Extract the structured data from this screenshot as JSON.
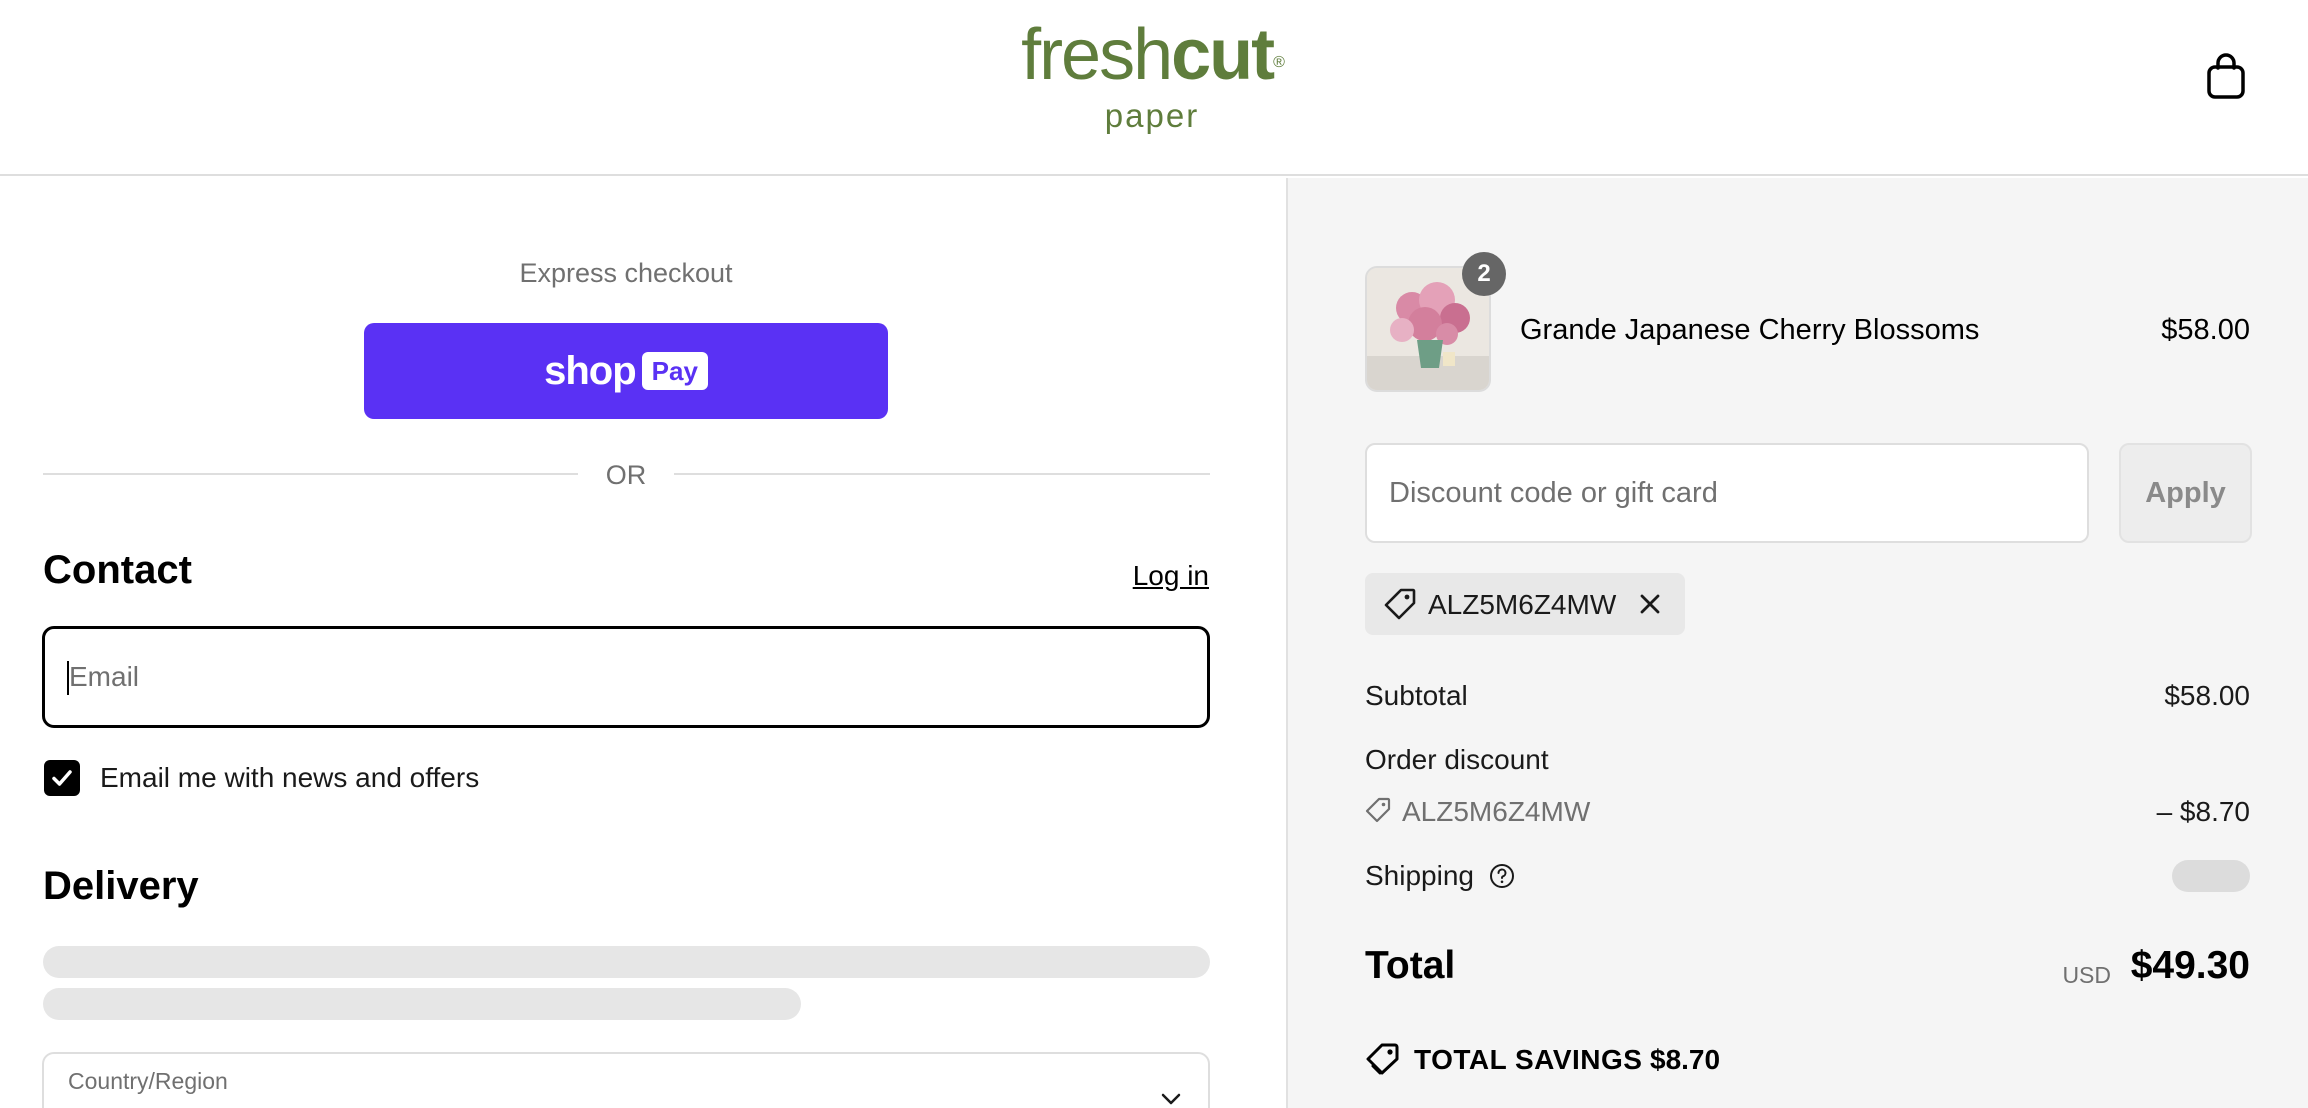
{
  "brand": {
    "logo_light": "fresh",
    "logo_bold": "cut",
    "logo_reg": "®",
    "logo_sub": "paper",
    "color": "#5f7d3c"
  },
  "header": {
    "cart_icon": "shopping-bag-icon"
  },
  "express": {
    "label": "Express checkout",
    "shop_pay_word": "shop",
    "shop_pay_badge": "Pay",
    "accent": "#5a31f4",
    "separator": "OR"
  },
  "contact": {
    "heading": "Contact",
    "login_link": "Log in",
    "email_placeholder": "Email",
    "email_value": "",
    "newsletter_label": "Email me with news and offers",
    "newsletter_checked": true
  },
  "delivery": {
    "heading": "Delivery",
    "country_label": "Country/Region",
    "country_value": ""
  },
  "summary": {
    "item": {
      "name": "Grande Japanese Cherry Blossoms",
      "price": "$58.00",
      "quantity": "2"
    },
    "discount_placeholder": "Discount code or gift card",
    "apply_label": "Apply",
    "applied_code": "ALZ5M6Z4MW",
    "subtotal_label": "Subtotal",
    "subtotal_value": "$58.00",
    "order_discount_label": "Order discount",
    "order_discount_code": "ALZ5M6Z4MW",
    "order_discount_value": "– $8.70",
    "shipping_label": "Shipping",
    "total_label": "Total",
    "total_currency": "USD",
    "total_value": "$49.30",
    "savings_label": "TOTAL SAVINGS",
    "savings_value": "$8.70"
  }
}
